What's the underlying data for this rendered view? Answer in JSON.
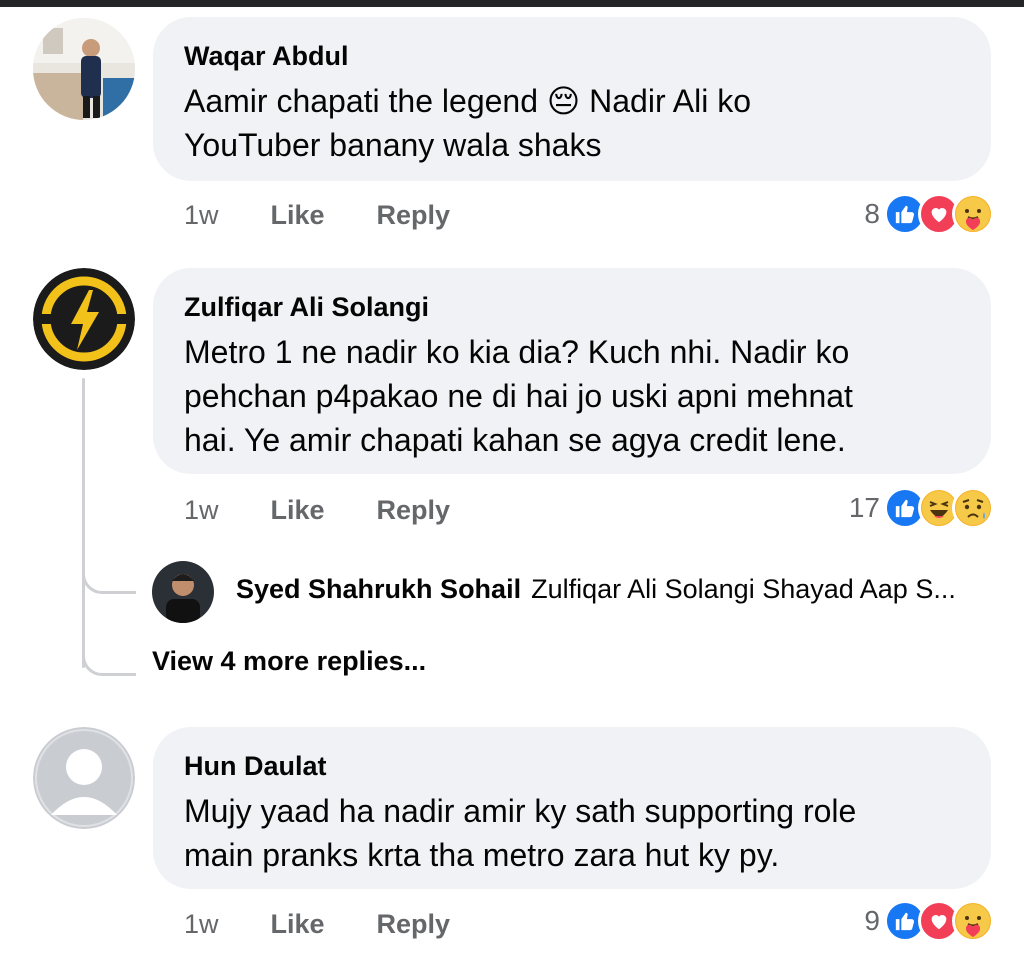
{
  "comments": [
    {
      "author": "Waqar Abdul",
      "text_line1": "Aamir chapati the legend 😔 Nadir Ali ko",
      "text_line2": "YouTuber banany wala shaks",
      "time": "1w",
      "like": "Like",
      "reply": "Reply",
      "reaction_count": "8",
      "reactions": [
        "like-icon",
        "love-icon",
        "care-icon"
      ]
    },
    {
      "author": "Zulfiqar Ali Solangi",
      "text_line1": "Metro 1 ne nadir ko kia dia? Kuch nhi. Nadir ko",
      "text_line2": "pehchan p4pakao ne di hai jo uski apni mehnat",
      "text_line3": "hai. Ye amir chapati kahan se agya credit lene.",
      "time": "1w",
      "like": "Like",
      "reply": "Reply",
      "reaction_count": "17",
      "reactions": [
        "like-icon",
        "haha-icon",
        "sad-icon"
      ],
      "reply_preview": {
        "author": "Syed Shahrukh Sohail",
        "text": "Zulfiqar Ali Solangi Shayad Aap S..."
      },
      "view_more": "View 4 more replies..."
    },
    {
      "author": "Hun Daulat",
      "text_line1": "Mujy yaad ha nadir amir ky sath supporting role",
      "text_line2": "main pranks krta tha metro zara hut ky py.",
      "time": "1w",
      "like": "Like",
      "reply": "Reply",
      "reaction_count": "9",
      "reactions": [
        "like-icon",
        "love-icon",
        "care-icon"
      ]
    }
  ],
  "colors": {
    "bubble": "#f0f2f5",
    "meta": "#65676b",
    "like_blue": "#1877f2",
    "love_red": "#f33e58",
    "emoji_yellow": "#f7b125"
  }
}
